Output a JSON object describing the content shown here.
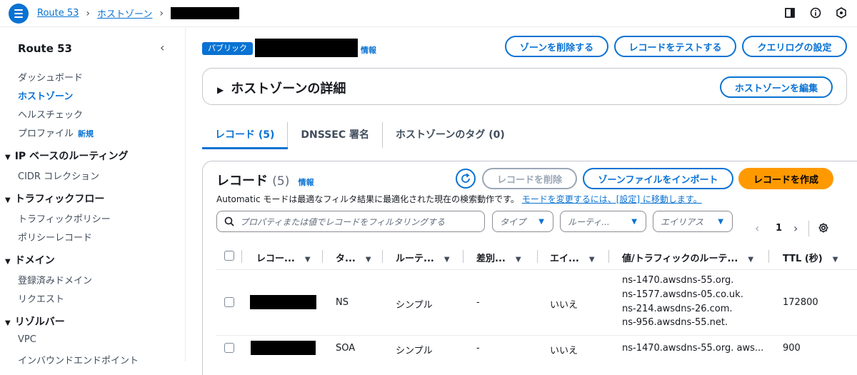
{
  "topbar": {
    "breadcrumb_root": "Route 53",
    "breadcrumb_hosted": "ホストゾーン"
  },
  "sidebar": {
    "title": "Route 53",
    "items": [
      {
        "label": "ダッシュボード"
      },
      {
        "label": "ホストゾーン"
      },
      {
        "label": "ヘルスチェック"
      },
      {
        "label": "プロファイル",
        "badge": "新規"
      }
    ],
    "sections": [
      {
        "label": "IP ベースのルーティング",
        "items": [
          "CIDR コレクション"
        ]
      },
      {
        "label": "トラフィックフロー",
        "items": [
          "トラフィックポリシー",
          "ポリシーレコード"
        ]
      },
      {
        "label": "ドメイン",
        "items": [
          "登録済みドメイン",
          "リクエスト"
        ]
      },
      {
        "label": "リゾルバー",
        "items": [
          "VPC",
          "インバウンドエンドポイント"
        ]
      }
    ]
  },
  "header": {
    "badge": "パブリック",
    "info": "情報",
    "buttons": {
      "delete_zone": "ゾーンを削除する",
      "test_record": "レコードをテストする",
      "query_log": "クエリログの設定"
    }
  },
  "details": {
    "title": "ホストゾーンの詳細",
    "edit_button": "ホストゾーンを編集"
  },
  "tabs": [
    {
      "label": "レコード (5)"
    },
    {
      "label": "DNSSEC 署名"
    },
    {
      "label": "ホストゾーンのタグ (0)"
    }
  ],
  "records": {
    "title": "レコード",
    "count": "(5)",
    "info": "情報",
    "delete_button": "レコードを削除",
    "import_button": "ゾーンファイルをインポート",
    "create_button": "レコードを作成",
    "mode_text": "Automatic モードは最適なフィルタ結果に最適化された現在の検索動作です。",
    "mode_link": "モードを変更するには、[設定] に移動します。",
    "search_placeholder": "プロパティまたは値でレコードをフィルタリングする",
    "filter_type": "タイプ",
    "filter_routing": "ルーティ...",
    "filter_alias": "エイリアス",
    "page": "1",
    "columns": [
      "レコー...",
      "タ...",
      "ルーテ...",
      "差別...",
      "エイ...",
      "値/トラフィックのルーテ...",
      "TTL (秒)"
    ],
    "rows": [
      {
        "type": "NS",
        "routing": "シンプル",
        "diff": "-",
        "alias": "いいえ",
        "values": [
          "ns-1470.awsdns-55.org.",
          "ns-1577.awsdns-05.co.uk.",
          "ns-214.awsdns-26.com.",
          "ns-956.awsdns-55.net."
        ],
        "ttl": "172800"
      },
      {
        "type": "SOA",
        "routing": "シンプル",
        "diff": "-",
        "alias": "いいえ",
        "values": [
          "ns-1470.awsdns-55.org. aws..."
        ],
        "ttl": "900"
      }
    ]
  }
}
